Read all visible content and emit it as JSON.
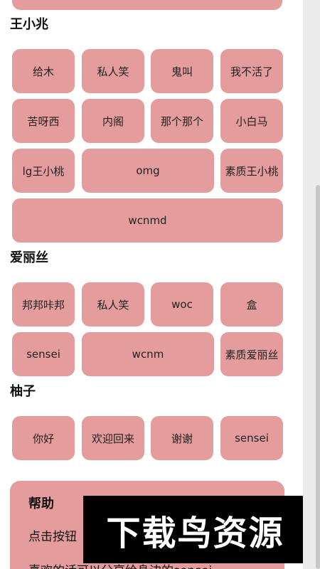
{
  "colors": {
    "button_bg": "#e49c9c",
    "text": "#222222",
    "title": "#111111",
    "watermark_bg": "#000000"
  },
  "sections": [
    {
      "title": "王小兆",
      "buttons": [
        "给木",
        "私人笑",
        "鬼叫",
        "我不活了",
        "苦呀西",
        "内阁",
        "那个那个",
        "小白马",
        "lg王小桃",
        "omg",
        "素质王小桃",
        "wcnmd"
      ]
    },
    {
      "title": "爱丽丝",
      "buttons": [
        "邦邦咔邦",
        "私人笑",
        "woc",
        "盒",
        "sensei",
        "wcnm",
        "素质爱丽丝"
      ]
    },
    {
      "title": "柚子",
      "buttons": [
        "你好",
        "欢迎回来",
        "谢谢",
        "sensei"
      ]
    }
  ],
  "help": {
    "title": "帮助",
    "line1": "点击按钮",
    "line2": "喜欢的话可以分享给身边的sensei"
  },
  "watermark": {
    "text": "下载鸟资源"
  }
}
